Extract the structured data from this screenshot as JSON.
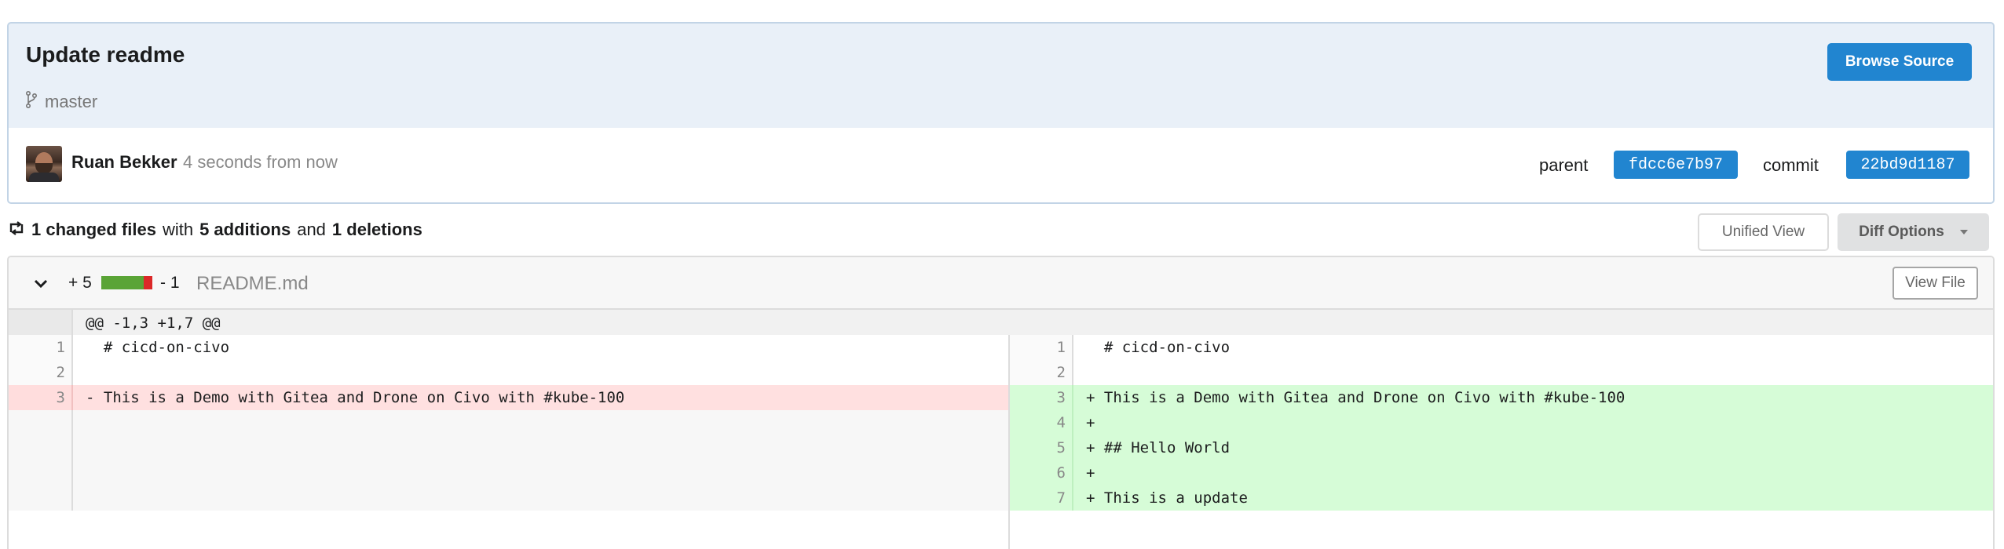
{
  "commit": {
    "title": "Update readme",
    "branch": "master",
    "browse_source_label": "Browse Source",
    "author_name": "Ruan Bekker",
    "author_time": "4 seconds from now",
    "parent_label": "parent",
    "parent_sha": "fdcc6e7b97",
    "commit_label": "commit",
    "commit_sha": "22bd9d1187"
  },
  "stats": {
    "changed_files": "1 changed files",
    "with": "with",
    "additions": "5 additions",
    "and": "and",
    "deletions": "1 deletions"
  },
  "view_controls": {
    "unified_view": "Unified View",
    "diff_options": "Diff Options"
  },
  "file": {
    "additions": "+ 5",
    "deletions": "- 1",
    "add_ratio": 0.83,
    "name": "README.md",
    "view_file_label": "View File",
    "hunk_header": "@@ -1,3 +1,7 @@",
    "left_lines": [
      {
        "num": "1",
        "text": "  # cicd-on-civo"
      },
      {
        "num": "2",
        "text": ""
      },
      {
        "num": "3",
        "text": "- This is a Demo with Gitea and Drone on Civo with #kube-100"
      }
    ],
    "right_lines": [
      {
        "num": "1",
        "text": "  # cicd-on-civo"
      },
      {
        "num": "2",
        "text": ""
      },
      {
        "num": "3",
        "text": "+ This is a Demo with Gitea and Drone on Civo with #kube-100"
      },
      {
        "num": "4",
        "text": "+"
      },
      {
        "num": "5",
        "text": "+ ## Hello World"
      },
      {
        "num": "6",
        "text": "+"
      },
      {
        "num": "7",
        "text": "+ This is a update"
      }
    ]
  },
  "colors": {
    "primary": "#2185d0",
    "header_bg": "#e9f0f8",
    "added_bg": "#d6fcd7",
    "deleted_bg": "#ffe0e0"
  }
}
